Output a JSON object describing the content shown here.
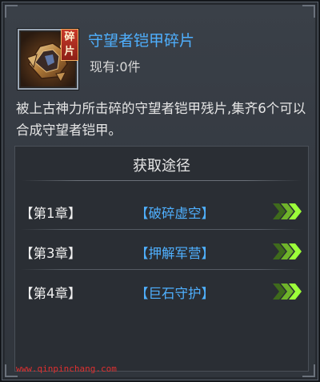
{
  "item": {
    "name": "守望者铠甲碎片",
    "count_label": "现有:0件",
    "fragment_tag": "碎片",
    "description": "被上古神力所击碎的守望者铠甲残片,集齐6个可以合成守望者铠甲。"
  },
  "sources": {
    "title": "获取途径",
    "rows": [
      {
        "chapter": "【第1章】",
        "place": "【破碎虚空】"
      },
      {
        "chapter": "【第3章】",
        "place": "【押解军营】"
      },
      {
        "chapter": "【第4章】",
        "place": "【巨石守护】"
      }
    ]
  },
  "watermark": "www.qinpinchang.com",
  "colors": {
    "name_blue": "#4fb0ff",
    "arrow_green": "#9cff3a",
    "fragment_red": "#c83a2a",
    "watermark_red": "#e03030"
  },
  "icons": {
    "item": "armor-fragment-icon",
    "go": "triple-chevron-right-icon"
  }
}
